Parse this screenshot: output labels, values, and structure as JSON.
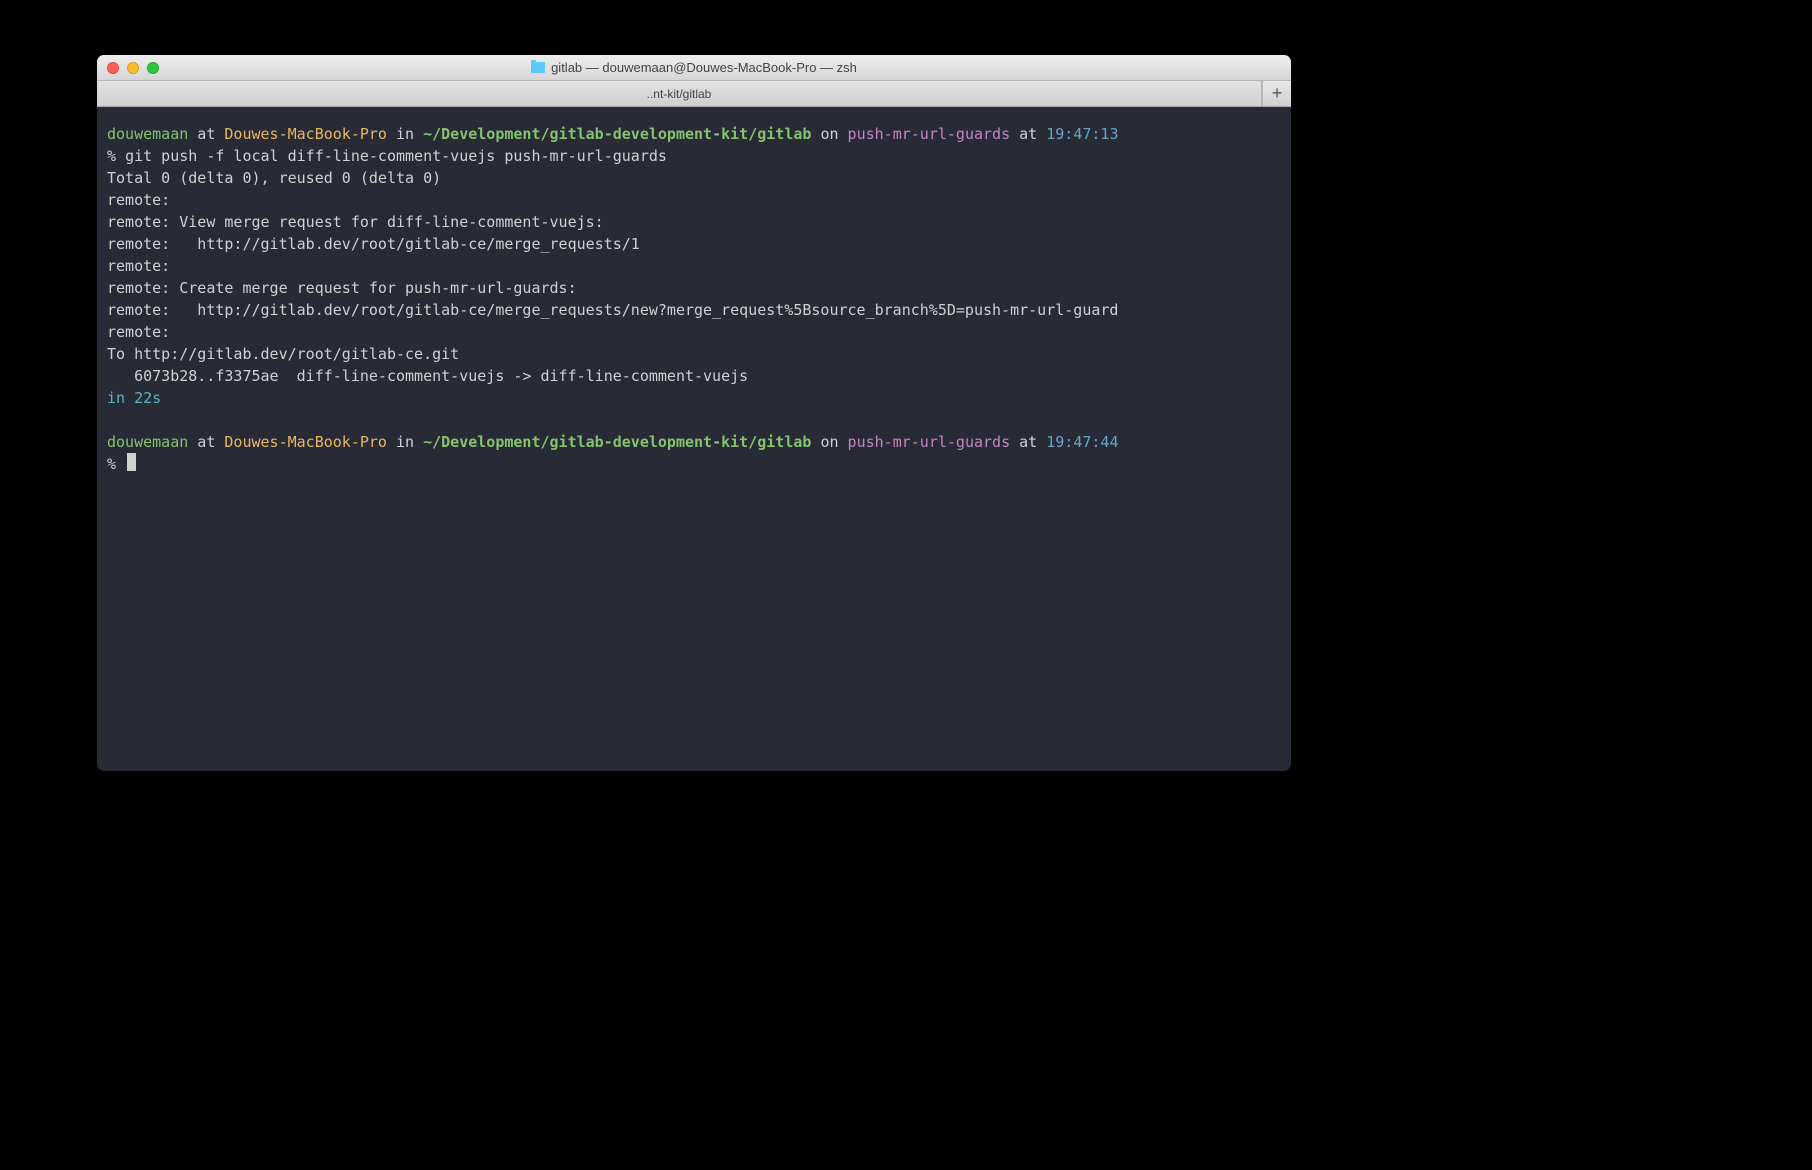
{
  "window": {
    "title": "gitlab — douwemaan@Douwes-MacBook-Pro — zsh",
    "tab": "..nt-kit/gitlab",
    "newtab_glyph": "+"
  },
  "colors": {
    "bg": "#282a36",
    "green": "#84c26d",
    "yellow": "#e7b75d",
    "blue": "#6aa1c9",
    "magenta": "#c584c0",
    "cyan": "#56b6c2"
  },
  "prompt1": {
    "user": "douwemaan",
    "at": " at ",
    "host": "Douwes-MacBook-Pro",
    "in": " in ",
    "path": "~/Development/gitlab-development-kit/gitlab",
    "on": " on ",
    "branch": "push-mr-url-guards",
    "at2": " at ",
    "time": "19:47:13",
    "symbol": "% ",
    "command": "git push -f local diff-line-comment-vuejs push-mr-url-guards"
  },
  "output": {
    "l0": "Total 0 (delta 0), reused 0 (delta 0)",
    "l1": "remote:",
    "l2": "remote: View merge request for diff-line-comment-vuejs:",
    "l3": "remote:   http://gitlab.dev/root/gitlab-ce/merge_requests/1",
    "l4": "remote:",
    "l5": "remote: Create merge request for push-mr-url-guards:",
    "l6": "remote:   http://gitlab.dev/root/gitlab-ce/merge_requests/new?merge_request%5Bsource_branch%5D=push-mr-url-guard",
    "l7": "remote:",
    "l8": "To http://gitlab.dev/root/gitlab-ce.git",
    "l9": "   6073b28..f3375ae  diff-line-comment-vuejs -> diff-line-comment-vuejs",
    "l10a": "in ",
    "l10b": "22s"
  },
  "prompt2": {
    "user": "douwemaan",
    "at": " at ",
    "host": "Douwes-MacBook-Pro",
    "in": " in ",
    "path": "~/Development/gitlab-development-kit/gitlab",
    "on": " on ",
    "branch": "push-mr-url-guards",
    "at2": " at ",
    "time": "19:47:44",
    "symbol": "% "
  }
}
